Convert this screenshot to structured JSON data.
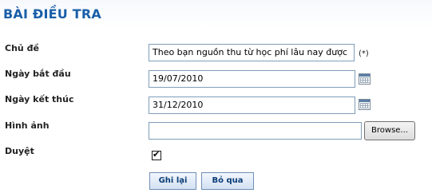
{
  "page": {
    "title": "BÀI ĐIỀU TRA"
  },
  "form": {
    "subject": {
      "label": "Chủ đề",
      "value": "Theo bạn nguồn thu từ học phí lâu nay được",
      "required_mark": "(*)"
    },
    "start_date": {
      "label": "Ngày bắt đầu",
      "value": "19/07/2010",
      "icon": "calendar-icon"
    },
    "end_date": {
      "label": "Ngày kết thúc",
      "value": "31/12/2010",
      "icon": "calendar-icon"
    },
    "image": {
      "label": "Hình ảnh",
      "value": "",
      "browse_label": "Browse..."
    },
    "approved": {
      "label": "Duyệt",
      "checked": true
    }
  },
  "actions": {
    "save_label": "Ghi lại",
    "cancel_label": "Bỏ qua"
  },
  "colors": {
    "title": "#1a5fa8",
    "input_border": "#7f9db9",
    "button_text": "#0b3d78"
  }
}
